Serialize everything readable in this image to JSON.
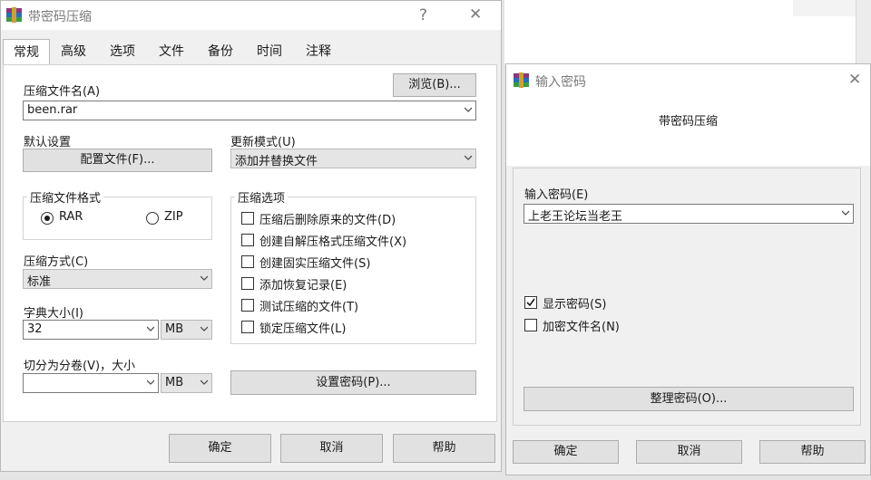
{
  "main_dialog": {
    "title": "带密码压缩",
    "help_glyph": "?",
    "close_glyph": "✕",
    "tabs": [
      "常规",
      "高级",
      "选项",
      "文件",
      "备份",
      "时间",
      "注释"
    ],
    "archive_name_label": "压缩文件名(A)",
    "browse_label": "浏览(B)...",
    "archive_name_value": "been.rar",
    "default_settings_label": "默认设置",
    "profiles_label": "配置文件(F)...",
    "update_mode_label": "更新模式(U)",
    "update_mode_value": "添加并替换文件",
    "format_group_label": "压缩文件格式",
    "format_rar": "RAR",
    "format_zip": "ZIP",
    "options_group_label": "压缩选项",
    "options": [
      {
        "label": "压缩后删除原来的文件(D)",
        "checked": false
      },
      {
        "label": "创建自解压格式压缩文件(X)",
        "checked": false
      },
      {
        "label": "创建固实压缩文件(S)",
        "checked": false
      },
      {
        "label": "添加恢复记录(E)",
        "checked": false
      },
      {
        "label": "测试压缩的文件(T)",
        "checked": false
      },
      {
        "label": "锁定压缩文件(L)",
        "checked": false
      }
    ],
    "method_label": "压缩方式(C)",
    "method_value": "标准",
    "dict_label": "字典大小(I)",
    "dict_value": "32",
    "dict_unit": "MB",
    "split_label": "切分为分卷(V)，大小",
    "split_value": "",
    "split_unit": "MB",
    "set_password_label": "设置密码(P)...",
    "ok_label": "确定",
    "cancel_label": "取消",
    "help_label": "帮助"
  },
  "password_dialog": {
    "title": "输入密码",
    "close_glyph": "✕",
    "heading": "带密码压缩",
    "enter_password_label": "输入密码(E)",
    "password_value": "上老王论坛当老王",
    "show_password_label": "显示密码(S)",
    "show_password_checked": true,
    "encrypt_names_label": "加密文件名(N)",
    "encrypt_names_checked": false,
    "organize_label": "整理密码(O)...",
    "ok_label": "确定",
    "cancel_label": "取消",
    "help_label": "帮助"
  },
  "colors": {
    "dialog_bg": "#f0f0f0",
    "button_bg": "#e1e1e1",
    "title_text": "#7a7a7a"
  }
}
